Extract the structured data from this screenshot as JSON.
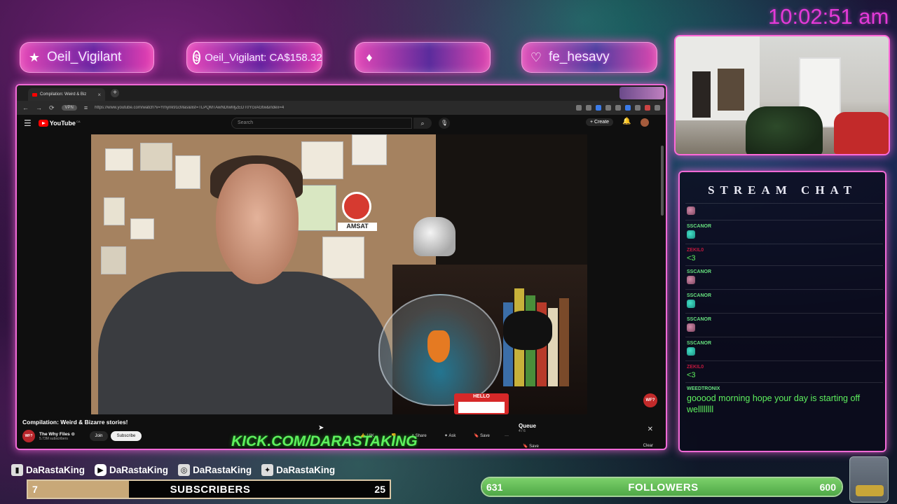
{
  "clock": "10:02:51 am",
  "banners": [
    {
      "icon": "star-icon",
      "glyph": "★",
      "text": "Oeil_Vigilant"
    },
    {
      "icon": "dollar-icon",
      "glyph": "$",
      "text": "Oeil_Vigilant: CA$158.32"
    },
    {
      "icon": "gem-icon",
      "glyph": "♦",
      "text": ""
    },
    {
      "icon": "heart-icon",
      "glyph": "♡",
      "text": "fe_hesavy"
    }
  ],
  "browser": {
    "tab_title": "Compilation: Weird & Biz",
    "url": "https://www.youtube.com/watch?v=Ymynk91cMas&list=TLPQMTAwNDIwMjZEDT0YcxAGtw&index=4",
    "url_pill": "VPN",
    "youtube": {
      "logo_text": "YouTube",
      "logo_region": "CA",
      "search_placeholder": "Search",
      "create_label": "+ Create",
      "video_title": "Compilation: Weird & Bizarre stories!",
      "channel_name": "The Why Files ⊙",
      "channel_subs": "5.73M subscribers",
      "channel_avatar": "WF?",
      "join_label": "Join",
      "subscribe_label": "Subscribe",
      "likes": "18K",
      "share_label": "Share",
      "ask_label": "Ask",
      "save_label": "Save",
      "more_label": "···",
      "hello_tag": "HELLO",
      "watermark": "WF?",
      "amsat": "AMSAT",
      "queue": {
        "title": "Queue",
        "count": "4 / 6",
        "save_label": "Save",
        "clear_label": "Clear"
      }
    }
  },
  "kick": "KICK.COM/DARASTAKING",
  "chat": {
    "title": "STREAM CHAT",
    "messages": [
      {
        "user": "SSCANOR",
        "text": "",
        "emote": "g",
        "user_color": "green"
      },
      {
        "user": "ZEKIL0",
        "text": "<3",
        "emote": "",
        "user_color": "red"
      },
      {
        "user": "SSCANOR",
        "text": "",
        "emote": "p",
        "user_color": "green"
      },
      {
        "user": "SSCANOR",
        "text": "",
        "emote": "g",
        "user_color": "green"
      },
      {
        "user": "SSCANOR",
        "text": "",
        "emote": "p",
        "user_color": "green"
      },
      {
        "user": "SSCANOR",
        "text": "",
        "emote": "g",
        "user_color": "green"
      },
      {
        "user": "ZEKIL0",
        "text": "<3",
        "emote": "",
        "user_color": "red"
      },
      {
        "user": "WEEDTRONIX",
        "text": "gooood morning hope your day is starting off wellllllll",
        "emote": "",
        "user_color": "green"
      }
    ]
  },
  "socials": [
    {
      "platform": "twitch-icon",
      "glyph": "▮",
      "handle": "DaRastaKing"
    },
    {
      "platform": "youtube-icon",
      "glyph": "▶",
      "handle": "DaRastaKing"
    },
    {
      "platform": "instagram-icon",
      "glyph": "◎",
      "handle": "DaRastaKing"
    },
    {
      "platform": "twitter-icon",
      "glyph": "✦",
      "handle": "DaRastaKing"
    }
  ],
  "subscribers": {
    "label": "SUBSCRIBERS",
    "current": "7",
    "goal": "25",
    "progress": 0.28
  },
  "followers": {
    "label": "FOLLOWERS",
    "current": "631",
    "goal": "600",
    "progress": 1.0
  },
  "colors": {
    "accent_pink": "#f06ad6",
    "kick_green": "#5ef05e",
    "clock_magenta": "#e43ad8"
  }
}
